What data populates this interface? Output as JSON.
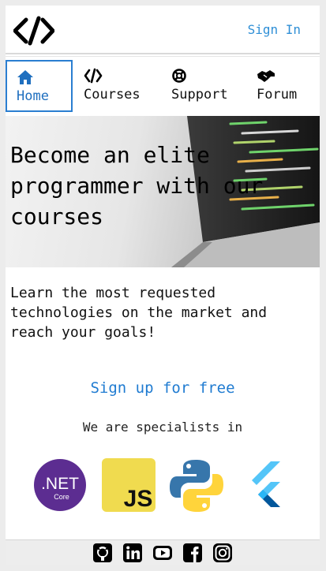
{
  "header": {
    "logo_icon": "code-icon",
    "signin_label": "Sign In",
    "accent_color": "#2f8fd6"
  },
  "nav": {
    "items": [
      {
        "label": "Home",
        "icon": "home-icon",
        "active": true
      },
      {
        "label": "Courses",
        "icon": "code-icon",
        "active": false
      },
      {
        "label": "Support",
        "icon": "lifebuoy-icon",
        "active": false
      },
      {
        "label": "Forum",
        "icon": "handshake-icon",
        "active": false
      }
    ]
  },
  "hero": {
    "title": "Become an elite programmer with our courses",
    "image": "laptop-with-code-photo"
  },
  "main": {
    "lead": "Learn the most requested technologies on the market and reach your goals!",
    "cta_label": "Sign up for free",
    "specialists_label": "We are specialists in",
    "technologies": [
      {
        "name": "dotnet-core-logo",
        "label_top": ".NET",
        "label_bottom": "Core",
        "color": "#5c2d91"
      },
      {
        "name": "javascript-logo",
        "label": "JS",
        "color": "#f0db4f"
      },
      {
        "name": "python-logo",
        "colors": [
          "#3776ab",
          "#ffd43b"
        ]
      },
      {
        "name": "flutter-logo",
        "colors": [
          "#54c5f8",
          "#01579b"
        ]
      }
    ]
  },
  "footer": {
    "social": [
      "github-icon",
      "linkedin-icon",
      "youtube-icon",
      "facebook-icon",
      "instagram-icon"
    ]
  }
}
